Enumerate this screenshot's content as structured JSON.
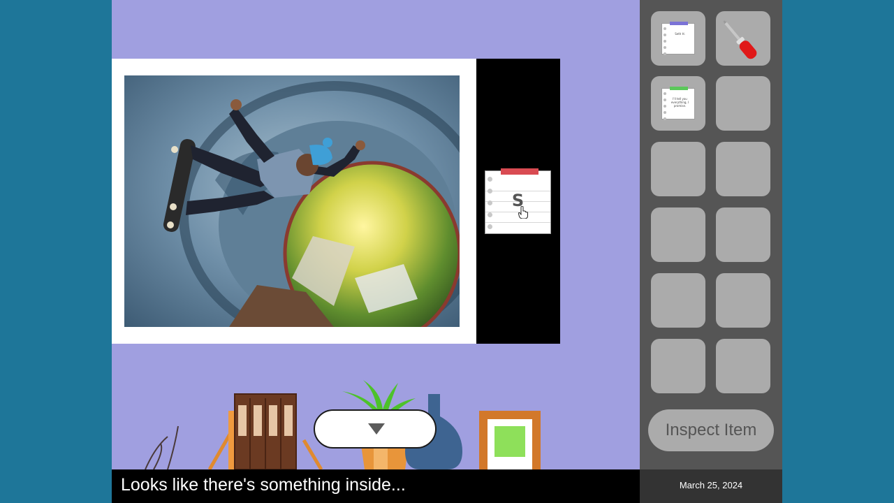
{
  "scene": {
    "caption": "Looks like there's something inside...",
    "note_letter": "S",
    "down_button_icon": "down-triangle-icon"
  },
  "inventory": {
    "slots": [
      {
        "item": "note",
        "tape_color": "#7b73d6",
        "text": "Seth H."
      },
      {
        "item": "screwdriver-icon"
      },
      {
        "item": "note",
        "tape_color": "#5bc85a",
        "text": "I'll tell you everything, I promise."
      },
      {
        "item": ""
      },
      {
        "item": ""
      },
      {
        "item": ""
      },
      {
        "item": ""
      },
      {
        "item": ""
      },
      {
        "item": ""
      },
      {
        "item": ""
      },
      {
        "item": ""
      },
      {
        "item": ""
      }
    ],
    "inspect_label": "Inspect Item"
  },
  "status": {
    "date": "March 25, 2024"
  },
  "colors": {
    "background": "#1e7699",
    "room_wall": "#a09fe0",
    "inventory_panel": "#555555",
    "slot": "#ababab",
    "note_tape": "#d94b52"
  }
}
